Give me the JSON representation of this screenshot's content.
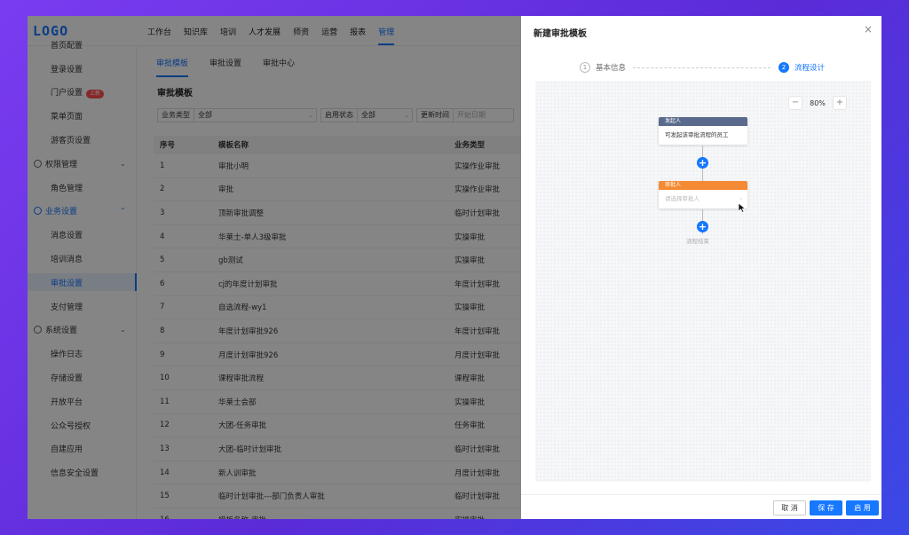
{
  "app": {
    "logo": "LOGO"
  },
  "nav": [
    "工作台",
    "知识库",
    "培训",
    "人才发展",
    "师资",
    "运营",
    "报表",
    "管理"
  ],
  "nav_active": "管理",
  "sidebar": {
    "top_partial": "首页配置",
    "items": [
      {
        "label": "登录设置",
        "type": "item"
      },
      {
        "label": "门户设置",
        "type": "item",
        "badge": "上新"
      },
      {
        "label": "菜单页面",
        "type": "item"
      },
      {
        "label": "游客页设置",
        "type": "item"
      },
      {
        "label": "权限管理",
        "type": "group"
      },
      {
        "label": "角色管理",
        "type": "item"
      },
      {
        "label": "业务设置",
        "type": "group",
        "expanded": true
      },
      {
        "label": "消息设置",
        "type": "item"
      },
      {
        "label": "培训消息",
        "type": "item"
      },
      {
        "label": "审批设置",
        "type": "item",
        "active": true
      },
      {
        "label": "支付管理",
        "type": "item"
      },
      {
        "label": "系统设置",
        "type": "group"
      },
      {
        "label": "操作日志",
        "type": "item"
      },
      {
        "label": "存储设置",
        "type": "item"
      },
      {
        "label": "开放平台",
        "type": "item"
      },
      {
        "label": "公众号授权",
        "type": "item"
      },
      {
        "label": "自建应用",
        "type": "item"
      },
      {
        "label": "信息安全设置",
        "type": "item"
      }
    ],
    "collapse_icon": "⇤"
  },
  "tabs": [
    "审批模板",
    "审批设置",
    "审批中心"
  ],
  "page_title": "审批模板",
  "filters": {
    "type_label": "业务类型",
    "type_value": "全部",
    "status_label": "启用状态",
    "status_value": "全部",
    "time_label": "更新时间",
    "time_placeholder": "开始日期"
  },
  "table": {
    "headers": [
      "序号",
      "模板名称",
      "业务类型"
    ],
    "rows": [
      [
        "1",
        "审批小明",
        "实操作业审批"
      ],
      [
        "2",
        "审批",
        "实操作业审批"
      ],
      [
        "3",
        "顶新审批调整",
        "临时计划审批"
      ],
      [
        "4",
        "华莱士-单人3级审批",
        "实操审批"
      ],
      [
        "5",
        "gb测试",
        "实操审批"
      ],
      [
        "6",
        "cj的年度计划审批",
        "年度计划审批"
      ],
      [
        "7",
        "自选流程-wy1",
        "实操审批"
      ],
      [
        "8",
        "年度计划审批926",
        "年度计划审批"
      ],
      [
        "9",
        "月度计划审批926",
        "月度计划审批"
      ],
      [
        "10",
        "课程审批流程",
        "课程审批"
      ],
      [
        "11",
        "华莱士会部",
        "实操审批"
      ],
      [
        "12",
        "大团-任务审批",
        "任务审批"
      ],
      [
        "13",
        "大团-临时计划审批",
        "临时计划审批"
      ],
      [
        "14",
        "新人训审批",
        "月度计划审批"
      ],
      [
        "15",
        "临时计划审批---部门负责人审批",
        "临时计划审批"
      ],
      [
        "16",
        "模板名称-审批",
        "实操审批"
      ]
    ]
  },
  "drawer": {
    "title": "新建审批模板",
    "close": "×",
    "steps": [
      {
        "num": "1",
        "label": "基本信息",
        "done": false
      },
      {
        "num": "2",
        "label": "流程设计",
        "done": true
      }
    ],
    "zoom": {
      "minus": "−",
      "value": "80%",
      "plus": "+"
    },
    "flow": {
      "initiator_header": "发起人",
      "initiator_body": "可发起该审批流程的员工",
      "approver_header": "审批人",
      "approver_body": "请选择审批人",
      "approver_arrow": "›",
      "plus": "+",
      "end": "流程结束",
      "initiator_color": "#5a6a8c",
      "approver_color": "#f58a34"
    },
    "buttons": {
      "cancel": "取 消",
      "save": "保 存",
      "enable": "启 用"
    }
  }
}
